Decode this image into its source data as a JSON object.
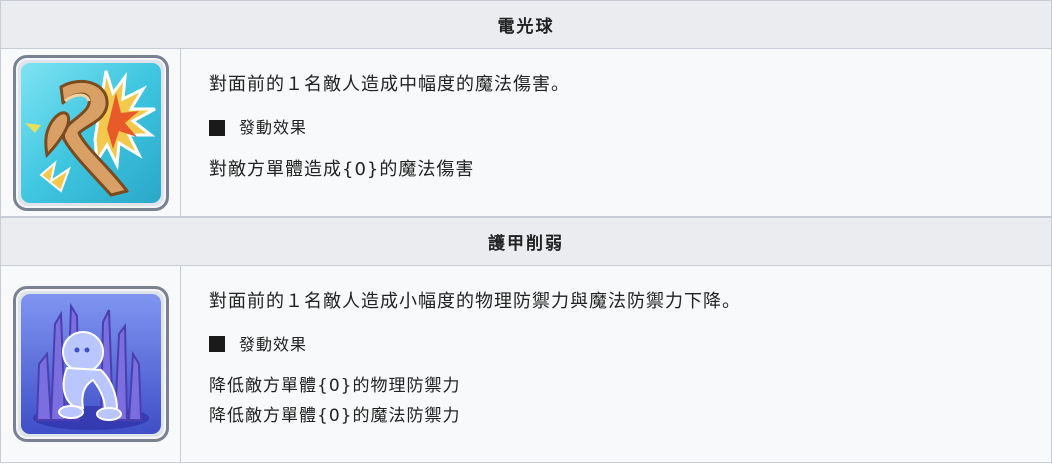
{
  "skills": [
    {
      "name": "電光球",
      "description": "對面前的１名敵人造成中幅度的魔法傷害。",
      "effect_title": "發動效果",
      "effects": [
        "對敵方單體造成{0}的魔法傷害"
      ],
      "icon": "lightning-boomerang-icon",
      "icon_colors": {
        "background": "#3fc6e0",
        "accent": "#f2c94c"
      }
    },
    {
      "name": "護甲削弱",
      "description": "對面前的１名敵人造成小幅度的物理防禦力與魔法防禦力下降。",
      "effect_title": "發動效果",
      "effects": [
        "降低敵方單體{0}的物理防禦力",
        "降低敵方單體{0}的魔法防禦力"
      ],
      "icon": "armor-break-crystal-icon",
      "icon_colors": {
        "background": "#5a6fe0",
        "accent": "#a29bfe"
      }
    }
  ]
}
